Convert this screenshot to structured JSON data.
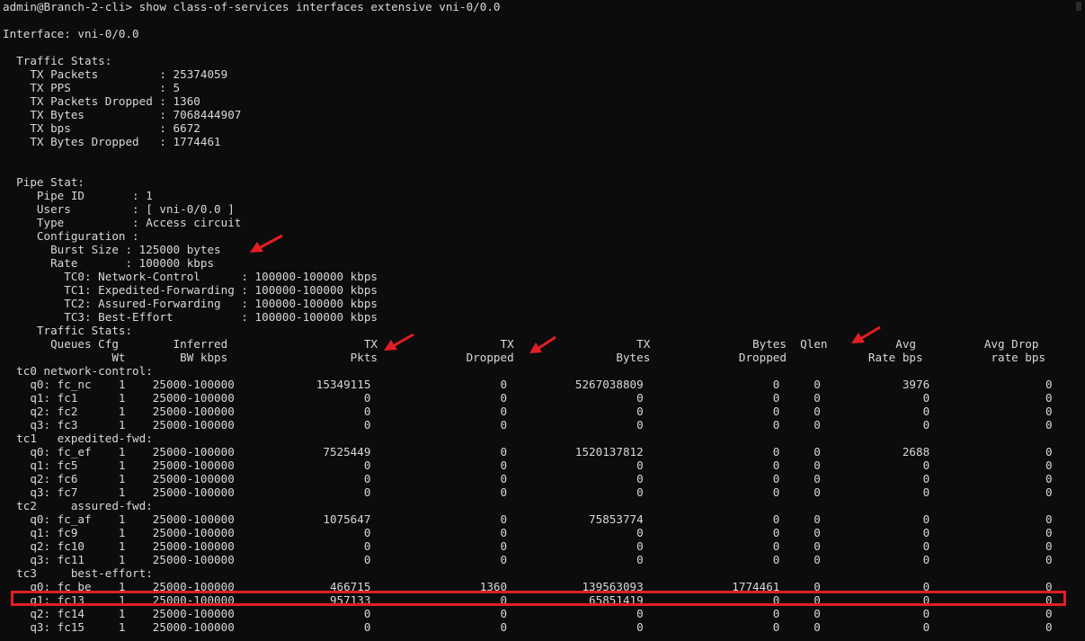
{
  "terminal": {
    "lines": [
      "admin@Branch-2-cli> show class-of-services interfaces extensive vni-0/0.0",
      "",
      "Interface: vni-0/0.0",
      "",
      "  Traffic Stats:",
      "    TX Packets         : 25374059",
      "    TX PPS             : 5",
      "    TX Packets Dropped : 1360",
      "    TX Bytes           : 7068444907",
      "    TX bps             : 6672",
      "    TX Bytes Dropped   : 1774461",
      "",
      "",
      "  Pipe Stat:",
      "     Pipe ID       : 1",
      "     Users         : [ vni-0/0.0 ]",
      "     Type          : Access circuit",
      "     Configuration :",
      "       Burst Size : 125000 bytes",
      "       Rate       : 100000 kbps",
      "         TC0: Network-Control      : 100000-100000 kbps",
      "         TC1: Expedited-Forwarding : 100000-100000 kbps",
      "         TC2: Assured-Forwarding   : 100000-100000 kbps",
      "         TC3: Best-Effort          : 100000-100000 kbps",
      "     Traffic Stats:",
      "       Queues Cfg        Inferred                    TX                  TX                  TX               Bytes  Qlen          Avg          Avg Drop",
      "                Wt        BW kbps                  Pkts             Dropped               Bytes             Dropped            Rate bps          rate bps",
      "  tc0 network-control:",
      "    q0: fc_nc    1    25000-100000            15349115                   0          5267038809                   0     0            3976                 0",
      "    q1: fc1      1    25000-100000                   0                   0                   0                   0     0               0                 0",
      "    q2: fc2      1    25000-100000                   0                   0                   0                   0     0               0                 0",
      "    q3: fc3      1    25000-100000                   0                   0                   0                   0     0               0                 0",
      "  tc1   expedited-fwd:",
      "    q0: fc_ef    1    25000-100000             7525449                   0          1520137812                   0     0            2688                 0",
      "    q1: fc5      1    25000-100000                   0                   0                   0                   0     0               0                 0",
      "    q2: fc6      1    25000-100000                   0                   0                   0                   0     0               0                 0",
      "    q3: fc7      1    25000-100000                   0                   0                   0                   0     0               0                 0",
      "  tc2     assured-fwd:",
      "    q0: fc_af    1    25000-100000             1075647                   0            75853774                   0     0               0                 0",
      "    q1: fc9      1    25000-100000                   0                   0                   0                   0     0               0                 0",
      "    q2: fc10     1    25000-100000                   0                   0                   0                   0     0               0                 0",
      "    q3: fc11     1    25000-100000                   0                   0                   0                   0     0               0                 0",
      "  tc3     best-effort:",
      "    q0: fc_be    1    25000-100000              466715                1360           139563093             1774461     0               0                 0",
      "    q1: fc13     1    25000-100000              957133                   0            65851419                   0     0               0                 0",
      "    q2: fc14     1    25000-100000                   0                   0                   0                   0     0               0                 0",
      "    q3: fc15     1    25000-100000                   0                   0                   0                   0     0               0                 0"
    ]
  },
  "annotations": {
    "arrow_color": "#e21e24",
    "highlight_color": "#e21e24"
  }
}
